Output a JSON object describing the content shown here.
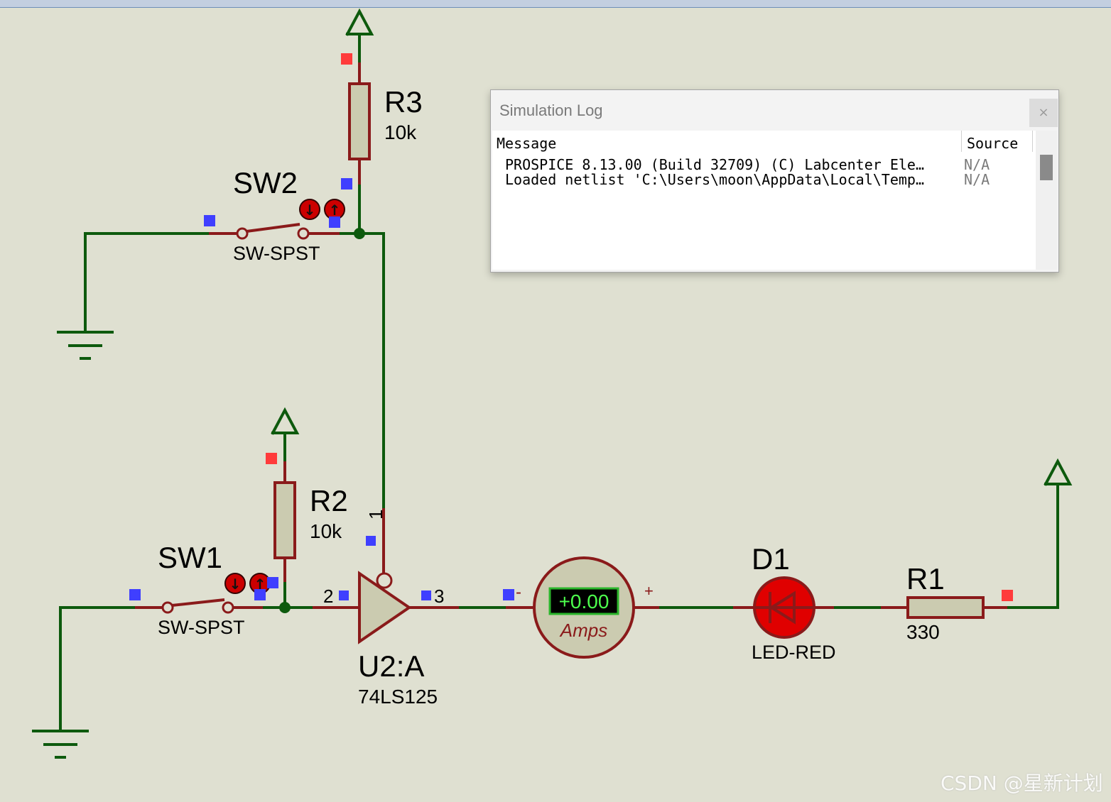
{
  "schematic": {
    "r3": {
      "ref": "R3",
      "value": "10k"
    },
    "r2": {
      "ref": "R2",
      "value": "10k"
    },
    "r1": {
      "ref": "R1",
      "value": "330"
    },
    "sw2": {
      "ref": "SW2",
      "type": "SW-SPST"
    },
    "sw1": {
      "ref": "SW1",
      "type": "SW-SPST"
    },
    "u2": {
      "ref": "U2:A",
      "part": "74LS125",
      "pin1": "1",
      "pin2": "2",
      "pin3": "3"
    },
    "ammeter": {
      "reading": "+0.00",
      "unit": "Amps",
      "minus": "-",
      "plus": "+"
    },
    "d1": {
      "ref": "D1",
      "type": "LED-RED"
    },
    "colors": {
      "wire": "#0d5a0d",
      "component": "#8a1a1a",
      "background": "#dfe0d1"
    }
  },
  "sim_log": {
    "title": "Simulation Log",
    "close": "×",
    "columns": {
      "message": "Message",
      "source": "Source"
    },
    "rows": [
      {
        "message": "PROSPICE 8.13.00 (Build 32709) (C) Labcenter Ele…",
        "source": "N/A"
      },
      {
        "message": "Loaded netlist 'C:\\Users\\moon\\AppData\\Local\\Temp…",
        "source": "N/A"
      }
    ]
  },
  "watermark": "CSDN @星新计划"
}
